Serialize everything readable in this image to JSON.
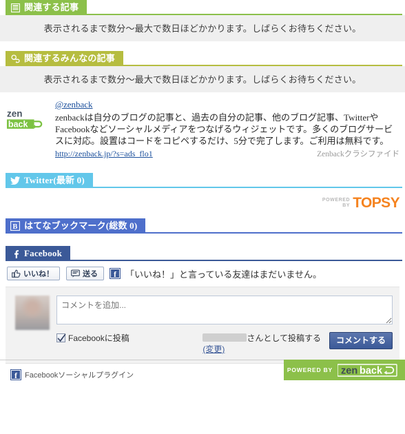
{
  "sections": {
    "related_articles": {
      "tab_label": "関連する記事",
      "icon": "article-list-icon",
      "notice": "表示されるまで数分〜最大で数日ほどかかります。しばらくお待ちください。",
      "color": "#8cc04a"
    },
    "related_everyone": {
      "tab_label": "関連するみんなの記事",
      "icon": "people-link-icon",
      "notice": "表示されるまで数分〜最大で数日ほどかかります。しばらくお待ちください。",
      "color": "#b6bd40"
    },
    "twitter": {
      "tab_label": "Twitter(最新 0)",
      "icon": "twitter-bird-icon",
      "color": "#62c7ea",
      "powered_by": {
        "powered": "POWERED",
        "by": "BY",
        "brand": "TOPSY",
        "brand_color": "#f5831f"
      }
    },
    "hatena": {
      "tab_label": "はてなブックマーク(総数 0)",
      "icon": "hatena-b-icon",
      "badge_letter": "B",
      "color": "#4e6fcb"
    },
    "facebook": {
      "tab_label": "Facebook",
      "icon": "facebook-f-icon",
      "color": "#3b5998",
      "like_button_label": "いいね！",
      "like_button_icon": "thumbs-up-icon",
      "send_button_label": "送る",
      "send_button_icon": "send-message-icon",
      "friends_status": "「いいね！」と言っている友達はまだいません。",
      "comment_placeholder": "コメントを追加...",
      "post_to_facebook_label": "Facebookに投稿",
      "post_to_facebook_checked": true,
      "posting_as_suffix": "さんとして投稿する",
      "change_link_label": "(変更)",
      "submit_label": "コメントする",
      "social_plugin_label": "Facebookソーシャルプラグイン"
    }
  },
  "ad": {
    "logo_text_1": "zen",
    "logo_text_2": "back",
    "handle": "@zenback",
    "description": "zenbackは自分のブログの記事と、過去の自分の記事、他のブログ記事、TwitterやFacebookなどソーシャルメディアをつなげるウィジェットです。多くのブログサービスに対応。設置はコードをコピペするだけ、5分で完了します。ご利用は無料です。",
    "url": "http://zenback.jp/?s=ads_flo1",
    "tag": "Zenbackクラシファイド"
  },
  "footer": {
    "powered_by": "POWERED BY",
    "brand_text_1": "zen",
    "brand_text_2": "back",
    "background": "#8cc04a"
  }
}
